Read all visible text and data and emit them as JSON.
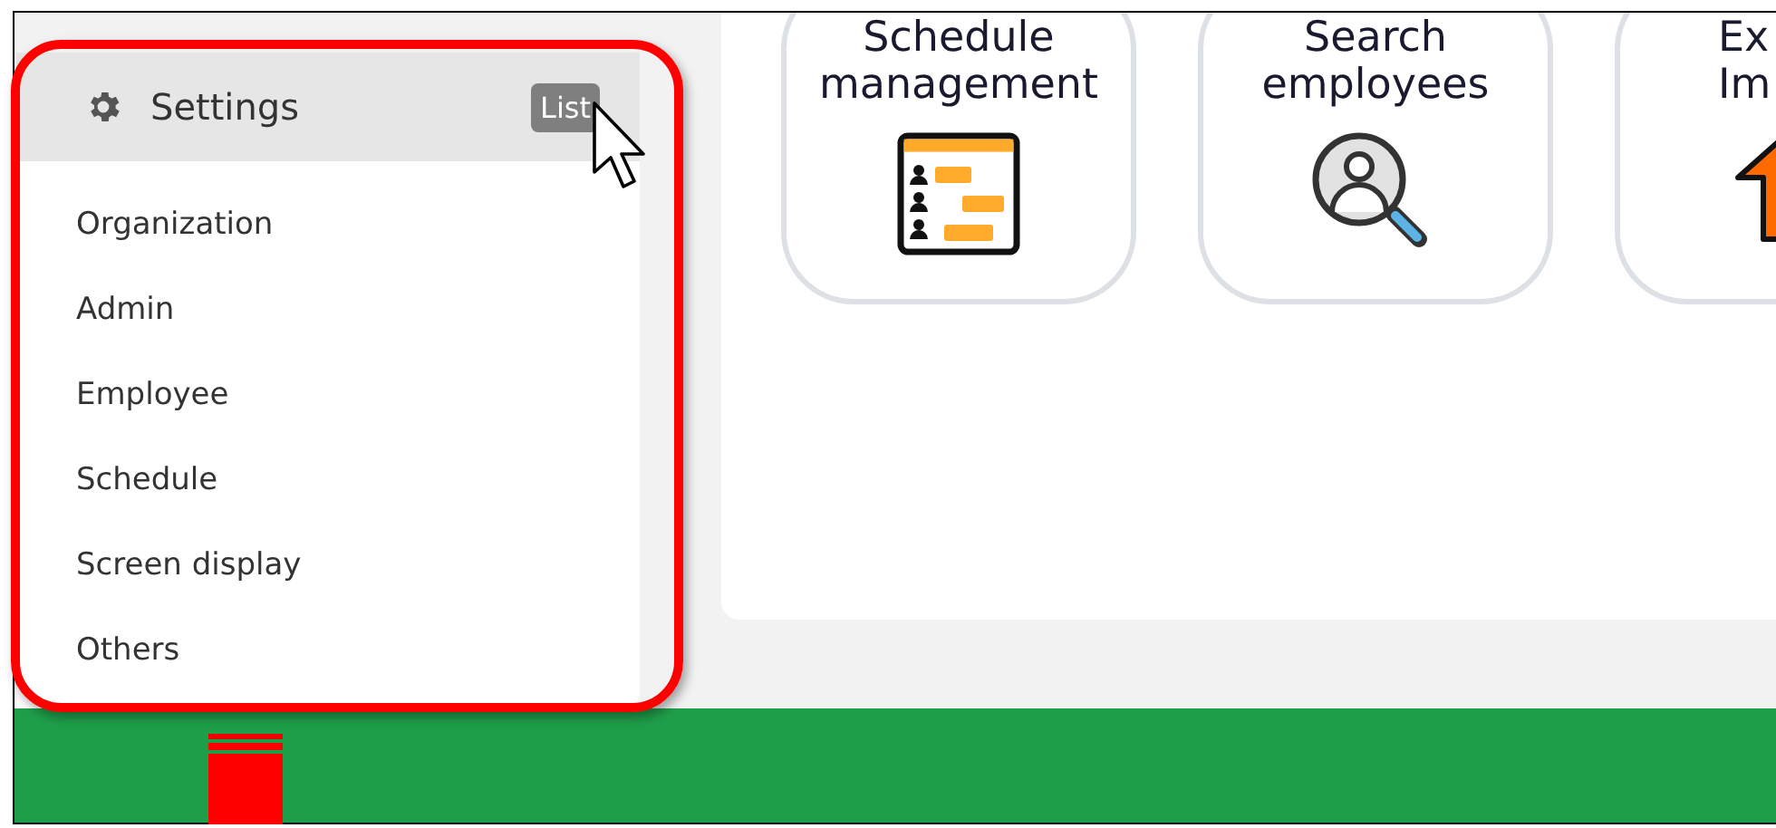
{
  "sidebar": {
    "title": "Settings",
    "button": "List",
    "items": [
      {
        "label": "Organization"
      },
      {
        "label": "Admin"
      },
      {
        "label": "Employee"
      },
      {
        "label": "Schedule"
      },
      {
        "label": "Screen display"
      },
      {
        "label": "Others"
      }
    ]
  },
  "cards": [
    {
      "kind": "schedule",
      "title_lines": [
        "Schedule",
        "management"
      ]
    },
    {
      "kind": "search",
      "title_lines": [
        "Search",
        "employees"
      ]
    },
    {
      "kind": "transfer",
      "title_lines": [
        "Ex",
        "Im"
      ]
    }
  ]
}
